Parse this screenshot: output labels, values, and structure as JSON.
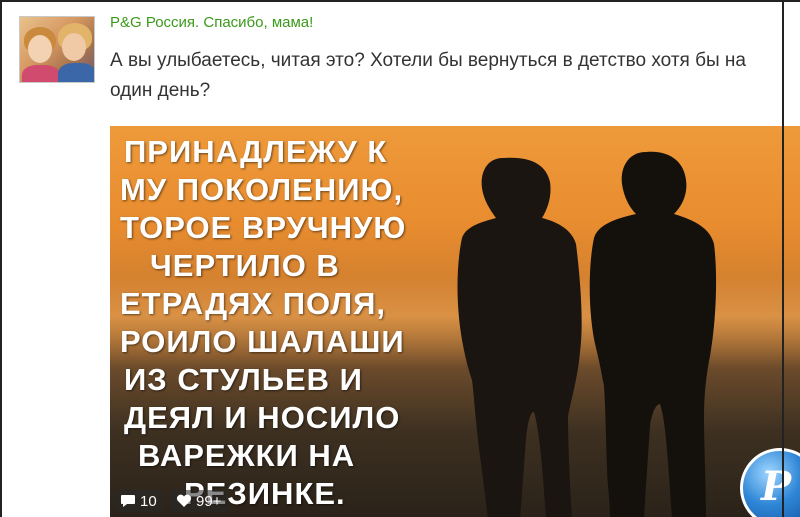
{
  "post": {
    "group_name": "P&G Россия. Спасибо, мама!",
    "text": "А вы улыбаетесь, читая это? Хотели бы вернуться в детство хотя бы на один день?"
  },
  "image": {
    "lines": [
      "ПРИНАДЛЕЖУ К",
      "МУ ПОКОЛЕНИЮ,",
      "ТОРОЕ ВРУЧНУЮ",
      "ЧЕРТИЛО В",
      "ЕТРАДЯХ ПОЛЯ,",
      "РОИЛО ШАЛАШИ",
      "ИЗ СТУЛЬЕВ И",
      "ДЕЯЛ И НОСИЛО",
      "ВАРЕЖКИ НА",
      "РЕЗИНКЕ."
    ],
    "logo_text": "P"
  },
  "stats": {
    "comments": "10",
    "likes": "99+"
  },
  "icons": {
    "comment": "comment-icon",
    "like": "like-icon"
  }
}
